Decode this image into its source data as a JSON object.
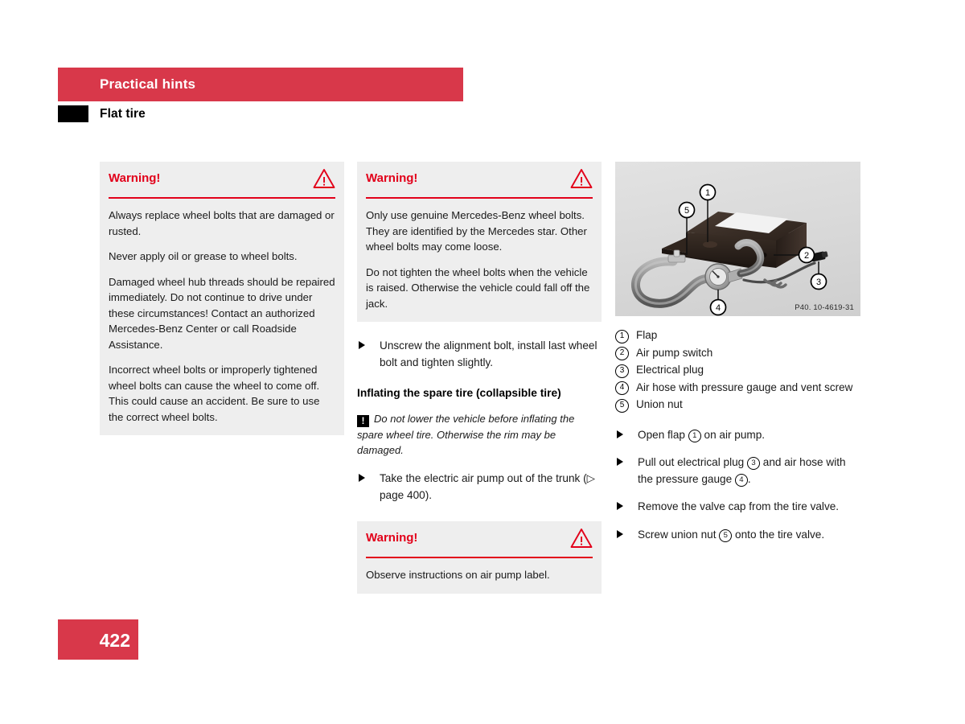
{
  "header": {
    "chapter_title": "Practical hints",
    "section_title": "Flat tire",
    "bar_color": "#d8384a",
    "tab_color": "#000000"
  },
  "colors": {
    "brand_red": "#d8384a",
    "warning_red": "#e2001a",
    "warning_bg": "#eeeeee",
    "figure_bg": "#dcdcdc"
  },
  "column_1": {
    "warning": {
      "title": "Warning!",
      "icon": "warning-triangle-icon",
      "paragraphs": [
        "Always replace wheel bolts that are damaged or rusted.",
        "Never apply oil or grease to wheel bolts.",
        "Damaged wheel hub threads should be repaired immediately. Do not continue to drive under these circumstances! Contact an authorized Mercedes-Benz Center or call Roadside Assistance.",
        "Incorrect wheel bolts or improperly tightened wheel bolts can cause the wheel to come off. This could cause an accident. Be sure to use the correct wheel bolts."
      ]
    }
  },
  "column_2": {
    "warning_top": {
      "title": "Warning!",
      "icon": "warning-triangle-icon",
      "paragraphs": [
        "Only use genuine Mercedes-Benz wheel bolts. They are identified by the Mercedes star. Other wheel bolts may come loose.",
        "Do not tighten the wheel bolts when the vehicle is raised. Otherwise the vehicle could fall off the jack."
      ]
    },
    "bullet_1": "Unscrew the alignment bolt, install last wheel bolt and tighten slightly.",
    "subheading": "Inflating the spare tire (collapsible tire)",
    "note": {
      "icon": "exclamation-box-icon",
      "text": "Do not lower the vehicle before inflating the spare wheel tire. Otherwise the rim may be damaged."
    },
    "bullet_2_pre": "Take the electric air pump out of the trunk (",
    "bullet_2_ref_arrow": "▷",
    "bullet_2_ref": " page 400",
    "bullet_2_post": ").",
    "warning_bottom": {
      "title": "Warning!",
      "icon": "warning-triangle-icon",
      "paragraphs": [
        "Observe instructions on air pump label."
      ]
    }
  },
  "column_3": {
    "figure": {
      "name": "air-pump-illustration",
      "figure_id": "P40. 10-4619-31",
      "callouts": [
        "1",
        "2",
        "3",
        "4",
        "5"
      ]
    },
    "legend": [
      {
        "num": "1",
        "label": "Flap"
      },
      {
        "num": "2",
        "label": "Air pump switch"
      },
      {
        "num": "3",
        "label": "Electrical plug"
      },
      {
        "num": "4",
        "label": "Air hose with pressure gauge and vent screw"
      },
      {
        "num": "5",
        "label": "Union nut"
      }
    ],
    "steps": [
      {
        "parts": [
          {
            "t": "text",
            "v": "Open flap "
          },
          {
            "t": "num",
            "v": "1"
          },
          {
            "t": "text",
            "v": " on air pump."
          }
        ]
      },
      {
        "parts": [
          {
            "t": "text",
            "v": "Pull out electrical plug "
          },
          {
            "t": "num",
            "v": "3"
          },
          {
            "t": "text",
            "v": " and air hose with the pressure gauge "
          },
          {
            "t": "num",
            "v": "4"
          },
          {
            "t": "text",
            "v": "."
          }
        ]
      },
      {
        "parts": [
          {
            "t": "text",
            "v": "Remove the valve cap from the tire valve."
          }
        ]
      },
      {
        "parts": [
          {
            "t": "text",
            "v": "Screw union nut "
          },
          {
            "t": "num",
            "v": "5"
          },
          {
            "t": "text",
            "v": " onto the tire valve."
          }
        ]
      }
    ]
  },
  "footer": {
    "page_number": "422"
  }
}
